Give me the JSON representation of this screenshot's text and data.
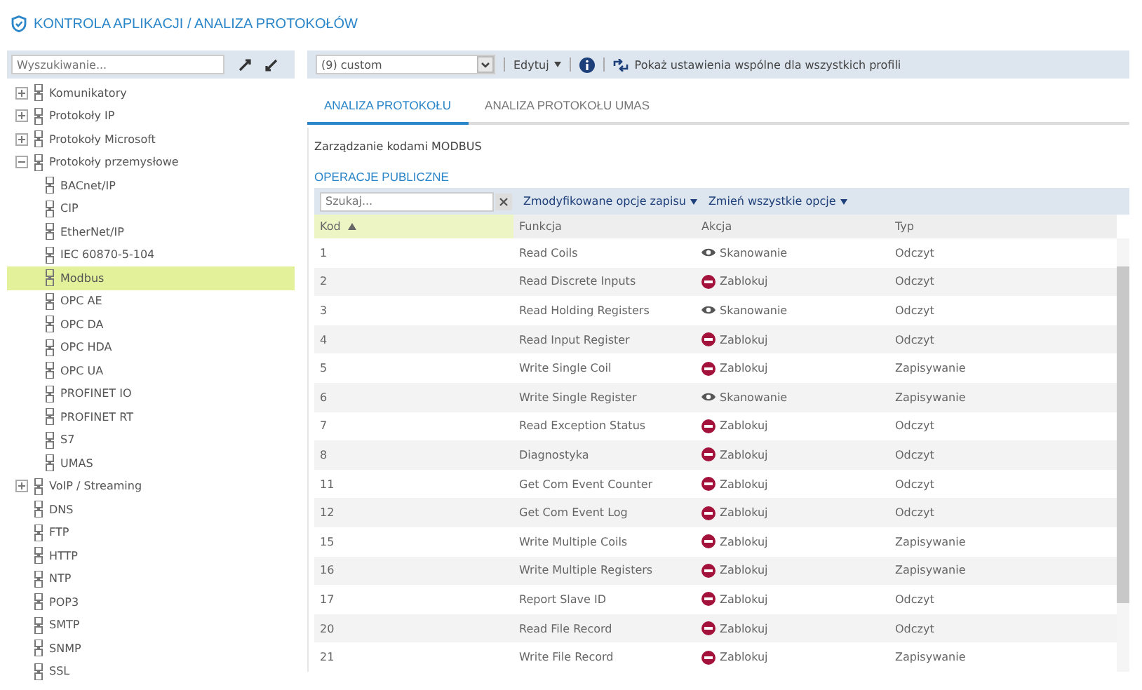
{
  "page_title": "KONTROLA APLIKACJI / ANALIZA PROTOKOŁÓW",
  "sidebar": {
    "search": {
      "placeholder": "Wyszukiwanie..."
    },
    "tree": [
      {
        "label": "Komunikatory",
        "expanded": false,
        "selected": false
      },
      {
        "label": "Protokoły IP",
        "expanded": false,
        "selected": false
      },
      {
        "label": "Protokoły Microsoft",
        "expanded": false,
        "selected": false
      },
      {
        "label": "Protokoły przemysłowe",
        "expanded": true,
        "selected": false,
        "children": [
          {
            "label": "BACnet/IP",
            "selected": false
          },
          {
            "label": "CIP",
            "selected": false
          },
          {
            "label": "EtherNet/IP",
            "selected": false
          },
          {
            "label": "IEC 60870-5-104",
            "selected": false
          },
          {
            "label": "Modbus",
            "selected": true
          },
          {
            "label": "OPC AE",
            "selected": false
          },
          {
            "label": "OPC DA",
            "selected": false
          },
          {
            "label": "OPC HDA",
            "selected": false
          },
          {
            "label": "OPC UA",
            "selected": false
          },
          {
            "label": "PROFINET IO",
            "selected": false
          },
          {
            "label": "PROFINET RT",
            "selected": false
          },
          {
            "label": "S7",
            "selected": false
          },
          {
            "label": "UMAS",
            "selected": false
          }
        ]
      },
      {
        "label": "VoIP / Streaming",
        "expanded": false,
        "selected": false
      }
    ],
    "leaves": [
      {
        "label": "DNS",
        "selected": false
      },
      {
        "label": "FTP",
        "selected": false
      },
      {
        "label": "HTTP",
        "selected": false
      },
      {
        "label": "NTP",
        "selected": false
      },
      {
        "label": "POP3",
        "selected": false
      },
      {
        "label": "SMTP",
        "selected": false
      },
      {
        "label": "SNMP",
        "selected": false
      },
      {
        "label": "SSL",
        "selected": false
      }
    ]
  },
  "toolbar": {
    "profile": "(9) custom",
    "edit": "Edytuj",
    "shared": "Pokaż ustawienia wspólne dla wszystkich profili"
  },
  "tabs": [
    {
      "label": "ANALIZA PROTOKOŁU",
      "selected": true
    },
    {
      "label": "ANALIZA PROTOKOŁU UMAS",
      "selected": false
    }
  ],
  "section_title": "Zarządzanie kodami MODBUS",
  "group_title": "OPERACJE PUBLICZNE",
  "filter": {
    "placeholder": "Szukaj...",
    "modified": "Zmodyfikowane opcje zapisu",
    "change_all": "Zmień wszystkie opcje"
  },
  "table": {
    "columns": [
      {
        "label": "Kod",
        "sorted": true
      },
      {
        "label": "Funkcja",
        "sorted": false
      },
      {
        "label": "Akcja",
        "sorted": false
      },
      {
        "label": "Typ",
        "sorted": false
      }
    ],
    "rows": [
      {
        "code": "1",
        "function": "Read Coils",
        "action": "Skanowanie",
        "kind": "scan",
        "type": "Odczyt"
      },
      {
        "code": "2",
        "function": "Read Discrete Inputs",
        "action": "Zablokuj",
        "kind": "block",
        "type": "Odczyt"
      },
      {
        "code": "3",
        "function": "Read Holding Registers",
        "action": "Skanowanie",
        "kind": "scan",
        "type": "Odczyt"
      },
      {
        "code": "4",
        "function": "Read Input Register",
        "action": "Zablokuj",
        "kind": "block",
        "type": "Odczyt"
      },
      {
        "code": "5",
        "function": "Write Single Coil",
        "action": "Zablokuj",
        "kind": "block",
        "type": "Zapisywanie"
      },
      {
        "code": "6",
        "function": "Write Single Register",
        "action": "Skanowanie",
        "kind": "scan",
        "type": "Zapisywanie"
      },
      {
        "code": "7",
        "function": "Read Exception Status",
        "action": "Zablokuj",
        "kind": "block",
        "type": "Odczyt"
      },
      {
        "code": "8",
        "function": "Diagnostyka",
        "action": "Zablokuj",
        "kind": "block",
        "type": "Odczyt"
      },
      {
        "code": "11",
        "function": "Get Com Event Counter",
        "action": "Zablokuj",
        "kind": "block",
        "type": "Odczyt"
      },
      {
        "code": "12",
        "function": "Get Com Event Log",
        "action": "Zablokuj",
        "kind": "block",
        "type": "Odczyt"
      },
      {
        "code": "15",
        "function": "Write Multiple Coils",
        "action": "Zablokuj",
        "kind": "block",
        "type": "Zapisywanie"
      },
      {
        "code": "16",
        "function": "Write Multiple Registers",
        "action": "Zablokuj",
        "kind": "block",
        "type": "Zapisywanie"
      },
      {
        "code": "17",
        "function": "Report Slave ID",
        "action": "Zablokuj",
        "kind": "block",
        "type": "Odczyt"
      },
      {
        "code": "20",
        "function": "Read File Record",
        "action": "Zablokuj",
        "kind": "block",
        "type": "Odczyt"
      },
      {
        "code": "21",
        "function": "Write File Record",
        "action": "Zablokuj",
        "kind": "block",
        "type": "Zapisywanie"
      }
    ]
  }
}
